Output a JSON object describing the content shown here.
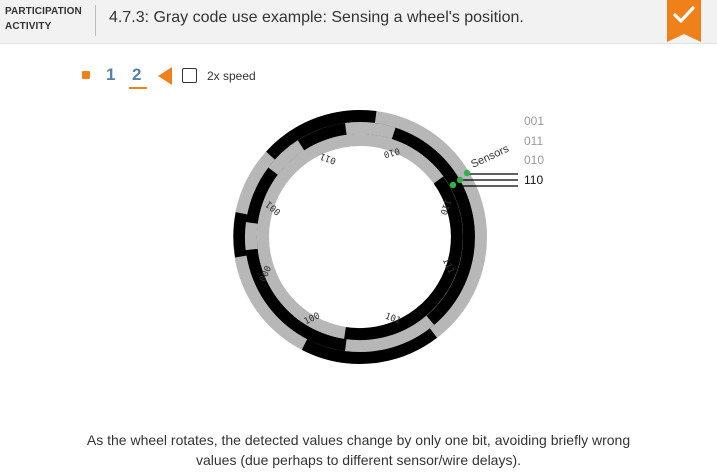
{
  "header": {
    "activity_label_line1": "PARTICIPATION",
    "activity_label_line2": "ACTIVITY",
    "title": "4.7.3: Gray code use example: Sensing a wheel's position.",
    "status_icon": "checkmark-icon",
    "accent_color": "#f0811a"
  },
  "controls": {
    "steps": [
      "1",
      "2"
    ],
    "current_step": "2",
    "play_icon": "play-triangle-icon",
    "speed_label": "2x speed",
    "speed_checked": false
  },
  "wheel": {
    "segment_labels": [
      "011",
      "010",
      "110",
      "111",
      "101",
      "100",
      "000",
      "001"
    ],
    "sensors_label": "Sensors",
    "sensor_values": [
      "001",
      "011",
      "010",
      "110"
    ],
    "current_value": "110",
    "sensor_color": "#2fb24a"
  },
  "caption": {
    "line1": "As the wheel rotates, the detected values change by only one bit, avoiding briefly wrong",
    "line2": "values (due perhaps to different sensor/wire delays)."
  }
}
